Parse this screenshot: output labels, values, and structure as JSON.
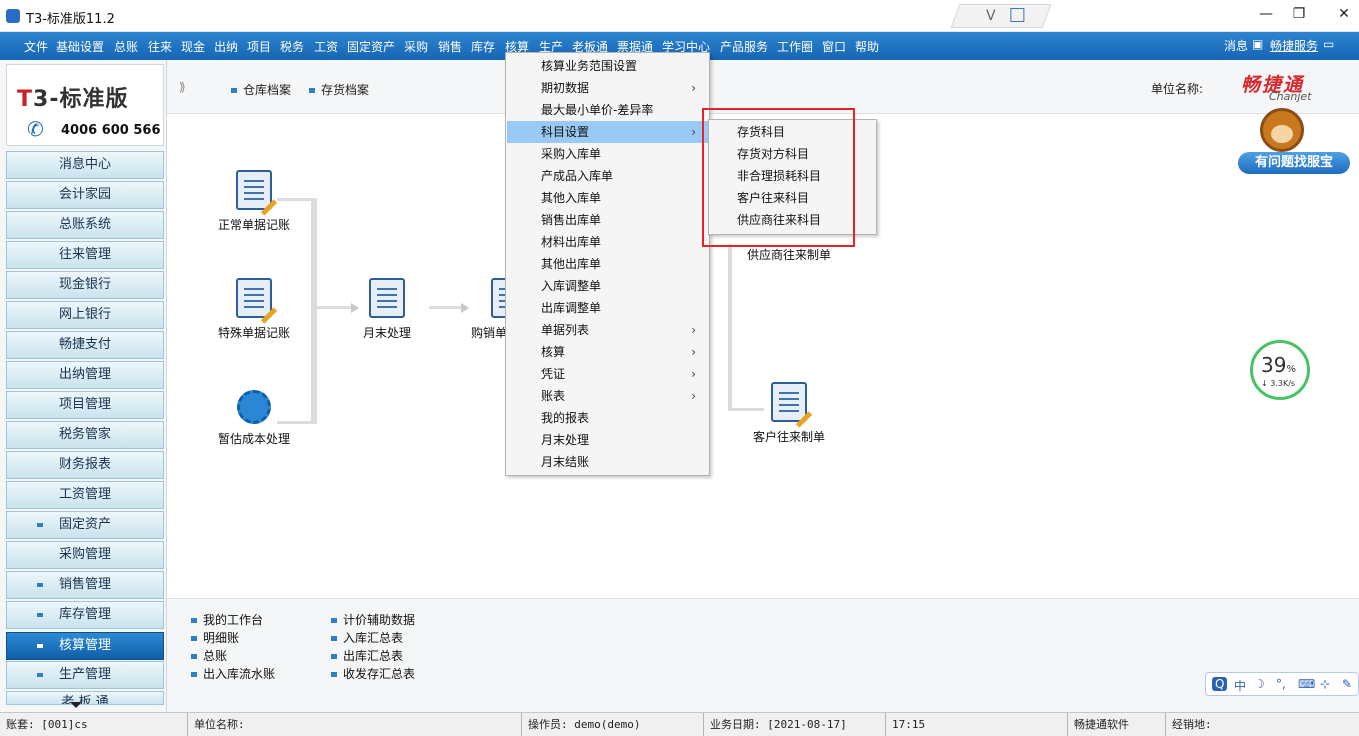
{
  "window": {
    "title": "T3-标准版11.2"
  },
  "menubar": {
    "items": [
      "文件",
      "基础设置",
      "总账",
      "往来",
      "现金",
      "出纳",
      "项目",
      "税务",
      "工资",
      "固定资产",
      "采购",
      "销售",
      "库存",
      "核算",
      "生产",
      "老板通",
      "票据通",
      "学习中心",
      "产品服务",
      "工作圈",
      "窗口",
      "帮助"
    ],
    "message": "消息",
    "service": "畅捷服务"
  },
  "logo": {
    "brand_t": "T",
    "brand_rest": "3-标准版",
    "phone": "4006 600 566"
  },
  "sidebar": {
    "items": [
      {
        "label": "消息中心"
      },
      {
        "label": "会计家园"
      },
      {
        "label": "总账系统"
      },
      {
        "label": "往来管理"
      },
      {
        "label": "现金银行"
      },
      {
        "label": "网上银行"
      },
      {
        "label": "畅捷支付"
      },
      {
        "label": "出纳管理"
      },
      {
        "label": "项目管理"
      },
      {
        "label": "税务管家"
      },
      {
        "label": "财务报表"
      },
      {
        "label": "工资管理"
      },
      {
        "label": "固定资产"
      },
      {
        "label": "采购管理"
      },
      {
        "label": "销售管理"
      },
      {
        "label": "库存管理"
      },
      {
        "label": "核算管理"
      },
      {
        "label": "生产管理"
      },
      {
        "label": "老 板 通"
      }
    ]
  },
  "toolbar": {
    "links": [
      "仓库档案",
      "存货档案"
    ],
    "unit_label": "单位名称:",
    "brand": "畅捷通",
    "brand_en": "Chanjet"
  },
  "flow": {
    "nodes": [
      "正常单据记账",
      "特殊单据记账",
      "暂估成本处理",
      "月末处理",
      "购销单",
      "供应商往来制单",
      "客户往来制单"
    ]
  },
  "helper": {
    "label": "有问题找服宝"
  },
  "speed": {
    "percent": "39",
    "percent_unit": "%",
    "rate": "↓ 3.3K/s"
  },
  "shortcuts": {
    "col1": [
      "我的工作台",
      "明细账",
      "总账",
      "出入库流水账"
    ],
    "col2": [
      "计价辅助数据",
      "入库汇总表",
      "出库汇总表",
      "收发存汇总表"
    ]
  },
  "ime": {
    "items": [
      "Q",
      "中",
      "☽",
      "°,",
      "⌨",
      "⊹",
      "✎"
    ]
  },
  "statusbar": {
    "account": "账套: [001]cs",
    "unit": "单位名称:",
    "operator": "操作员: demo(demo)",
    "date": "业务日期: [2021-08-17]",
    "time": "17:15",
    "vendor": "畅捷通软件",
    "distributor": "经销地:"
  },
  "dropdown": {
    "items": [
      {
        "label": "核算业务范围设置",
        "arrow": ""
      },
      {
        "label": "期初数据",
        "arrow": "›"
      },
      {
        "label": "最大最小单价-差异率",
        "arrow": ""
      },
      {
        "label": "科目设置",
        "arrow": "›"
      },
      {
        "label": "采购入库单",
        "arrow": ""
      },
      {
        "label": "产成品入库单",
        "arrow": ""
      },
      {
        "label": "其他入库单",
        "arrow": ""
      },
      {
        "label": "销售出库单",
        "arrow": ""
      },
      {
        "label": "材料出库单",
        "arrow": ""
      },
      {
        "label": "其他出库单",
        "arrow": ""
      },
      {
        "label": "入库调整单",
        "arrow": ""
      },
      {
        "label": "出库调整单",
        "arrow": ""
      },
      {
        "label": "单据列表",
        "arrow": "›"
      },
      {
        "label": "核算",
        "arrow": "›"
      },
      {
        "label": "凭证",
        "arrow": "›"
      },
      {
        "label": "账表",
        "arrow": "›"
      },
      {
        "label": "我的报表",
        "arrow": ""
      },
      {
        "label": "月末处理",
        "arrow": ""
      },
      {
        "label": "月末结账",
        "arrow": ""
      }
    ],
    "highlighted": "科目设置"
  },
  "submenu": {
    "items": [
      "存货科目",
      "存货对方科目",
      "非合理损耗科目",
      "客户往来科目",
      "供应商往来科目"
    ]
  },
  "colors": {
    "menubar": "#1f75c3",
    "active_nav": "#1672bd",
    "highlight": "#99c9f4",
    "annotation": "#e0262b"
  }
}
